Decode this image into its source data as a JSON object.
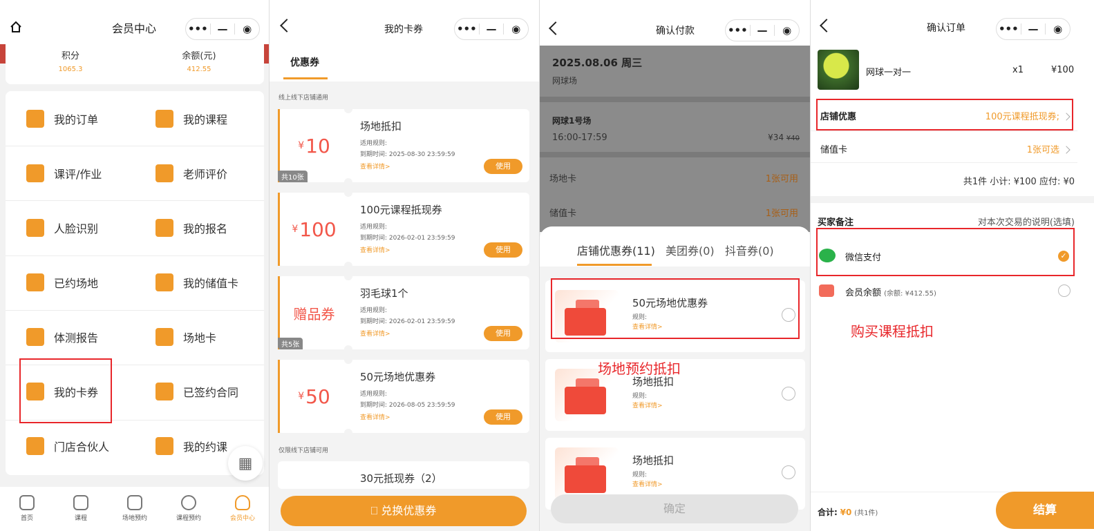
{
  "panel1": {
    "title": "会员中心",
    "stats": [
      {
        "label": "积分",
        "value": "1065.3"
      },
      {
        "label": "余额(元)",
        "value": "412.55"
      }
    ],
    "menu": [
      {
        "label": "我的订单",
        "icon": "clipboard-icon"
      },
      {
        "label": "我的课程",
        "icon": "book-icon"
      },
      {
        "label": "课评/作业",
        "icon": "open-book-icon"
      },
      {
        "label": "老师评价",
        "icon": "star-icon"
      },
      {
        "label": "人脸识别",
        "icon": "face-scan-icon"
      },
      {
        "label": "我的报名",
        "icon": "flag-icon"
      },
      {
        "label": "已约场地",
        "icon": "map-pin-icon"
      },
      {
        "label": "我的储值卡",
        "icon": "yen-card-icon"
      },
      {
        "label": "体测报告",
        "icon": "report-icon"
      },
      {
        "label": "场地卡",
        "icon": "star-icon"
      },
      {
        "label": "我的卡券",
        "icon": "ticket-icon"
      },
      {
        "label": "已签约合同",
        "icon": "contract-icon"
      },
      {
        "label": "门店合伙人",
        "icon": "handshake-icon"
      },
      {
        "label": "我的约课",
        "icon": "clipboard-icon"
      }
    ],
    "tabs": [
      {
        "label": "首页"
      },
      {
        "label": "课程"
      },
      {
        "label": "场地预约"
      },
      {
        "label": "课程预约"
      },
      {
        "label": "会员中心"
      }
    ]
  },
  "panel2": {
    "title": "我的卡券",
    "tab": "优惠券",
    "section1": "线上线下店铺通用",
    "section2": "仅限线下店铺可用",
    "coupons": [
      {
        "amount": "10",
        "currency": "¥",
        "title": "场地抵扣",
        "rule": "适用规则:",
        "expire": "到期时间:  2025-08-30 23:59:59",
        "detail": "查看详情>",
        "use": "使用",
        "count": "共10张"
      },
      {
        "amount": "100",
        "currency": "¥",
        "title": "100元课程抵现券",
        "rule": "适用规则:",
        "expire": "到期时间:  2026-02-01 23:59:59",
        "detail": "查看详情>",
        "use": "使用",
        "count": ""
      },
      {
        "amount": "赠品券",
        "currency": "",
        "title": "羽毛球1个",
        "rule": "适用规则:",
        "expire": "到期时间:  2026-02-01 23:59:59",
        "detail": "查看详情>",
        "use": "使用",
        "count": "共5张"
      },
      {
        "amount": "50",
        "currency": "¥",
        "title": "50元场地优惠券",
        "rule": "适用规则:",
        "expire": "到期时间:  2026-08-05 23:59:59",
        "detail": "查看详情>",
        "use": "使用",
        "count": ""
      }
    ],
    "partial_coupon": "30元抵现券（2）",
    "exchange": "兑换优惠券"
  },
  "panel3": {
    "title": "确认付款",
    "date": "2025.08.06 周三",
    "venue": "网球场",
    "court": "网球1号场",
    "time": "16:00-17:59",
    "price": "¥34",
    "orig_price": "¥40",
    "rows": [
      {
        "label": "场地卡",
        "value": "1张可用"
      },
      {
        "label": "储值卡",
        "value": "1张可用"
      }
    ],
    "tabs": [
      {
        "label": "店铺优惠券(11)"
      },
      {
        "label": "美团券(0)"
      },
      {
        "label": "抖音券(0)"
      }
    ],
    "vouchers": [
      {
        "title": "50元场地优惠券",
        "rule": "规则:",
        "detail": "查看详情>"
      },
      {
        "title": "场地抵扣",
        "rule": "规则:",
        "detail": "查看详情>"
      },
      {
        "title": "场地抵扣",
        "rule": "规则:",
        "detail": "查看详情>"
      }
    ],
    "annotation": "场地预约抵扣",
    "confirm": "确定"
  },
  "panel4": {
    "title": "确认订单",
    "product": "网球一对一",
    "qty": "x1",
    "price": "¥100",
    "store_discount_label": "店铺优惠",
    "store_discount_value": "100元课程抵现券;",
    "card_label": "储值卡",
    "card_value": "1张可选",
    "summary": "共1件  小计: ¥100  应付: ¥0",
    "remark_label": "买家备注",
    "remark_placeholder": "对本次交易的说明(选填)",
    "pay_wechat": "微信支付",
    "pay_balance": "会员余额",
    "pay_balance_note": "(余额: ¥412.55)",
    "annotation": "购买课程抵扣",
    "total_label": "合计:",
    "total_value": "¥0",
    "total_note": "(共1件)",
    "checkout": "结算"
  },
  "colors": {
    "accent": "#f09a2a",
    "red": "#f2574a",
    "annotation": "#e8262a"
  }
}
